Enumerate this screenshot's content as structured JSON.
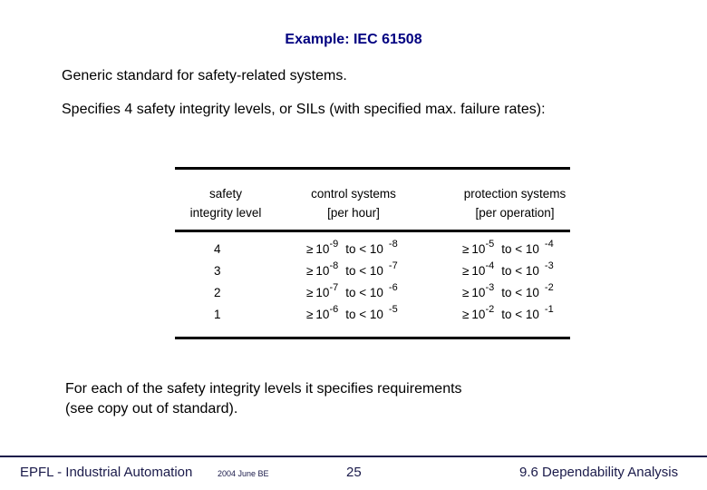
{
  "slide": {
    "title": "Example: IEC 61508",
    "line1": "Generic standard for safety-related systems.",
    "line2": "Specifies 4 safety integrity levels, or SILs (with specified max. failure rates):",
    "table": {
      "headers": [
        {
          "line1": "safety",
          "line2": "integrity level"
        },
        {
          "line1": "control systems",
          "line2": "[per hour]"
        },
        {
          "line1": "protection systems",
          "line2": "[per operation]"
        }
      ],
      "ge_symbol": "≥",
      "base": "10",
      "to_text": "to < 10",
      "rows": [
        {
          "level": "4",
          "control": {
            "lo": "-9",
            "hi": "-8"
          },
          "protection": {
            "lo": "-5",
            "hi": "-4"
          }
        },
        {
          "level": "3",
          "control": {
            "lo": "-8",
            "hi": "-7"
          },
          "protection": {
            "lo": "-4",
            "hi": "-3"
          }
        },
        {
          "level": "2",
          "control": {
            "lo": "-7",
            "hi": "-6"
          },
          "protection": {
            "lo": "-3",
            "hi": "-2"
          }
        },
        {
          "level": "1",
          "control": {
            "lo": "-6",
            "hi": "-5"
          },
          "protection": {
            "lo": "-2",
            "hi": "-1"
          }
        }
      ]
    },
    "para3_line1": "For each of the safety integrity levels it specifies requirements",
    "para3_line2": "(see copy out of standard)."
  },
  "footer": {
    "org": "EPFL - Industrial Automation",
    "date": "2004 June BE",
    "page": "25",
    "section": "9.6 Dependability Analysis"
  },
  "colors": {
    "title": "#000080",
    "footer": "#1a1a4a"
  }
}
